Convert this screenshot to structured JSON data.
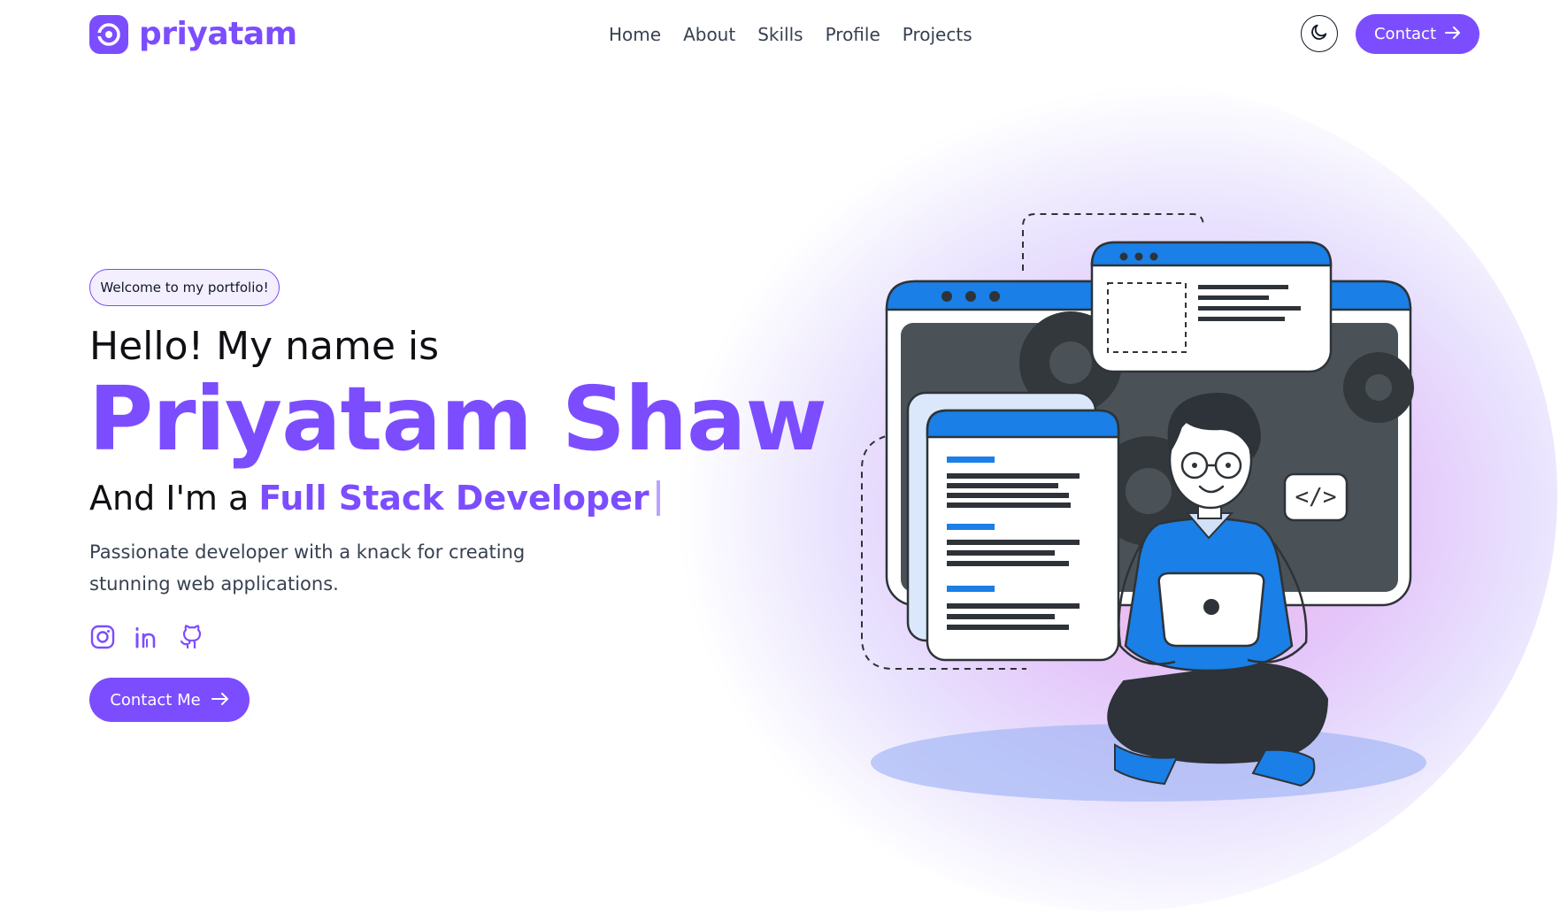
{
  "brand": {
    "name": "priyatam",
    "accent": "#7c4dff"
  },
  "nav": {
    "links": [
      {
        "label": "Home"
      },
      {
        "label": "About"
      },
      {
        "label": "Skills"
      },
      {
        "label": "Profile"
      },
      {
        "label": "Projects"
      }
    ],
    "theme_toggle_icon": "moon-icon",
    "contact_label": "Contact"
  },
  "hero": {
    "badge": "Welcome to my portfolio!",
    "greeting": "Hello! My name is",
    "name": "Priyatam Shaw",
    "role_prefix": "And I'm a",
    "role": "Full Stack Developer",
    "tagline": "Passionate developer with a knack for creating stunning web applications.",
    "socials": [
      {
        "icon": "instagram-icon"
      },
      {
        "icon": "linkedin-icon"
      },
      {
        "icon": "github-icon"
      }
    ],
    "cta_label": "Contact Me"
  },
  "illustration": {
    "code_tag": "</>",
    "colors": {
      "blue": "#1a7fe6",
      "dark": "#2d3338",
      "screen": "#4b5257"
    }
  }
}
